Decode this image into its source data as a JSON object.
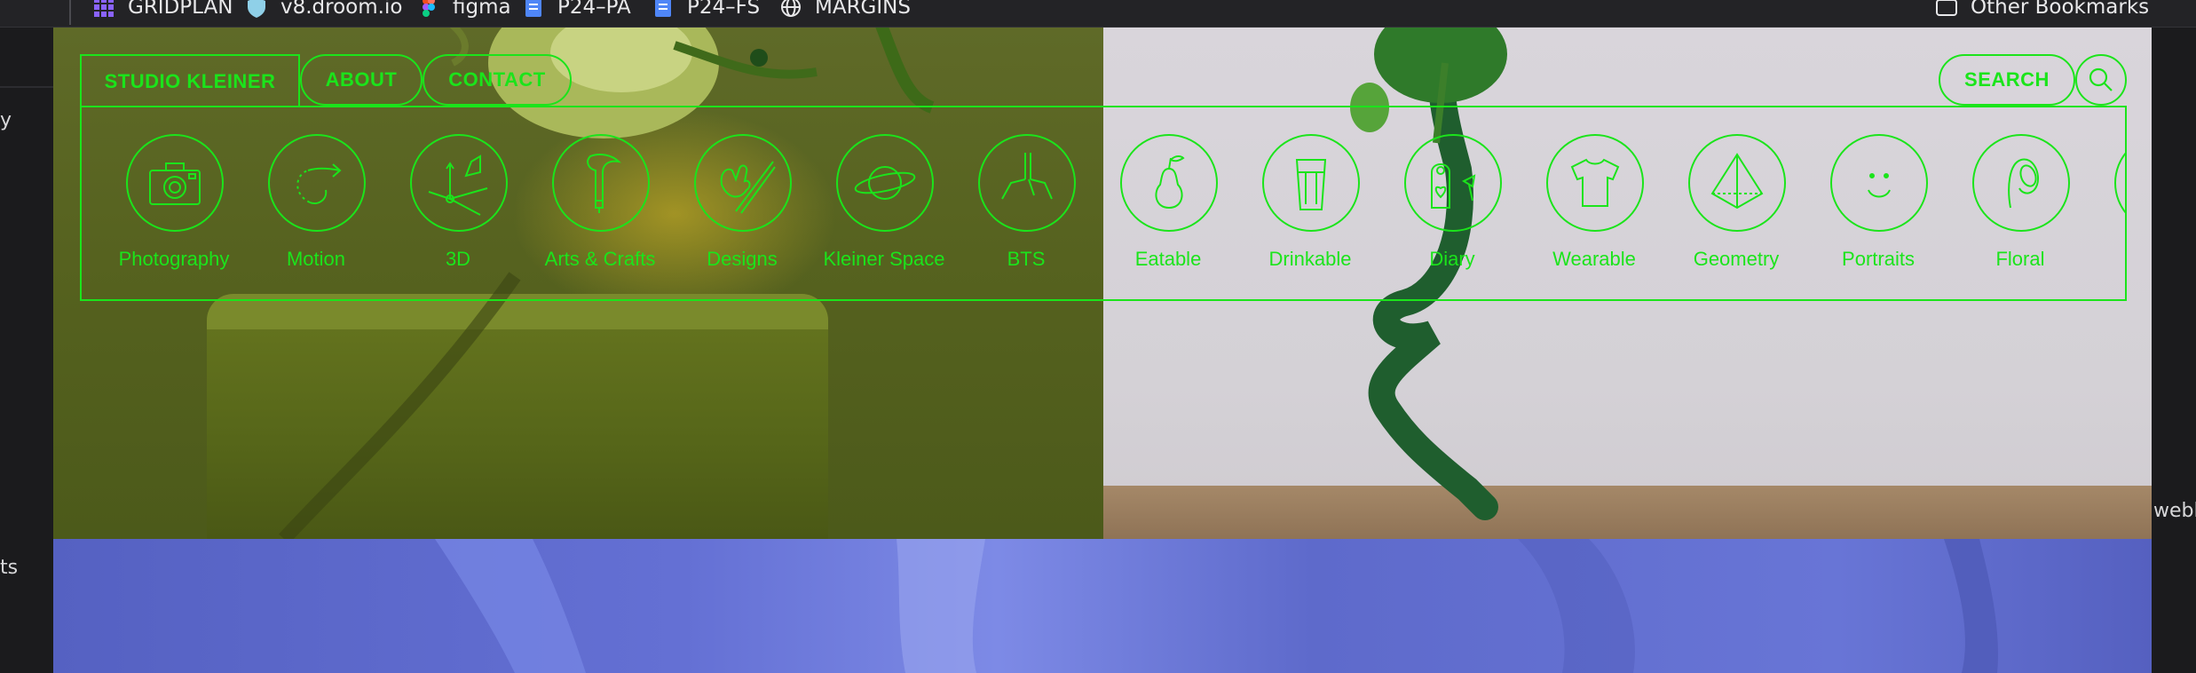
{
  "browser": {
    "bookmarks": [
      {
        "label": "GRIDPLAN",
        "icon": "grid-icon"
      },
      {
        "label": "v8.droom.io",
        "icon": "shield-icon"
      },
      {
        "label": "figma",
        "icon": "figma-icon"
      },
      {
        "label": "P24–PA",
        "icon": "doc-icon"
      },
      {
        "label": "P24–FS",
        "icon": "doc-icon"
      },
      {
        "label": "MARGINS",
        "icon": "globe-icon"
      }
    ],
    "other_bookmarks": "Other Bookmarks",
    "left_strip_texts": [
      "y",
      "ts"
    ],
    "right_strip_text": "webl"
  },
  "nav": {
    "brand": "STUDIO KLEINER",
    "about": "ABOUT",
    "contact": "CONTACT",
    "search": "SEARCH"
  },
  "categories": [
    {
      "label": "Photography",
      "icon": "camera-icon"
    },
    {
      "label": "Motion",
      "icon": "motion-arrow-icon"
    },
    {
      "label": "3D",
      "icon": "3d-axes-icon"
    },
    {
      "label": "Arts & Crafts",
      "icon": "hammer-icon"
    },
    {
      "label": "Designs",
      "icon": "hand-pencil-icon"
    },
    {
      "label": "Kleiner Space",
      "icon": "planet-icon"
    },
    {
      "label": "BTS",
      "icon": "light-stand-icon"
    },
    {
      "label": "Eatable",
      "icon": "pear-icon"
    },
    {
      "label": "Drinkable",
      "icon": "glass-icon"
    },
    {
      "label": "Diary",
      "icon": "door-hanger-icon"
    },
    {
      "label": "Wearable",
      "icon": "tshirt-icon"
    },
    {
      "label": "Geometry",
      "icon": "pyramid-icon"
    },
    {
      "label": "Portraits",
      "icon": "smiley-icon"
    },
    {
      "label": "Floral",
      "icon": "flower-icon"
    }
  ],
  "colors": {
    "accent": "#1be41b",
    "left_panel": "#56621f",
    "right_panel": "#d6d3d8",
    "bottom_panel": "#6470d4"
  }
}
